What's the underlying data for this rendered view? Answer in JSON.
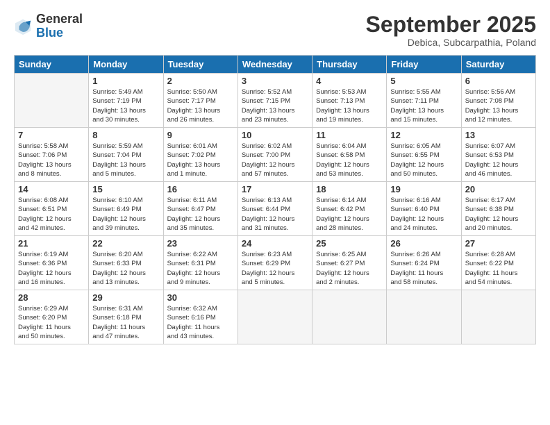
{
  "header": {
    "logo_general": "General",
    "logo_blue": "Blue",
    "month_title": "September 2025",
    "subtitle": "Debica, Subcarpathia, Poland"
  },
  "weekdays": [
    "Sunday",
    "Monday",
    "Tuesday",
    "Wednesday",
    "Thursday",
    "Friday",
    "Saturday"
  ],
  "weeks": [
    [
      {
        "day": "",
        "info": ""
      },
      {
        "day": "1",
        "info": "Sunrise: 5:49 AM\nSunset: 7:19 PM\nDaylight: 13 hours\nand 30 minutes."
      },
      {
        "day": "2",
        "info": "Sunrise: 5:50 AM\nSunset: 7:17 PM\nDaylight: 13 hours\nand 26 minutes."
      },
      {
        "day": "3",
        "info": "Sunrise: 5:52 AM\nSunset: 7:15 PM\nDaylight: 13 hours\nand 23 minutes."
      },
      {
        "day": "4",
        "info": "Sunrise: 5:53 AM\nSunset: 7:13 PM\nDaylight: 13 hours\nand 19 minutes."
      },
      {
        "day": "5",
        "info": "Sunrise: 5:55 AM\nSunset: 7:11 PM\nDaylight: 13 hours\nand 15 minutes."
      },
      {
        "day": "6",
        "info": "Sunrise: 5:56 AM\nSunset: 7:08 PM\nDaylight: 13 hours\nand 12 minutes."
      }
    ],
    [
      {
        "day": "7",
        "info": "Sunrise: 5:58 AM\nSunset: 7:06 PM\nDaylight: 13 hours\nand 8 minutes."
      },
      {
        "day": "8",
        "info": "Sunrise: 5:59 AM\nSunset: 7:04 PM\nDaylight: 13 hours\nand 5 minutes."
      },
      {
        "day": "9",
        "info": "Sunrise: 6:01 AM\nSunset: 7:02 PM\nDaylight: 13 hours\nand 1 minute."
      },
      {
        "day": "10",
        "info": "Sunrise: 6:02 AM\nSunset: 7:00 PM\nDaylight: 12 hours\nand 57 minutes."
      },
      {
        "day": "11",
        "info": "Sunrise: 6:04 AM\nSunset: 6:58 PM\nDaylight: 12 hours\nand 53 minutes."
      },
      {
        "day": "12",
        "info": "Sunrise: 6:05 AM\nSunset: 6:55 PM\nDaylight: 12 hours\nand 50 minutes."
      },
      {
        "day": "13",
        "info": "Sunrise: 6:07 AM\nSunset: 6:53 PM\nDaylight: 12 hours\nand 46 minutes."
      }
    ],
    [
      {
        "day": "14",
        "info": "Sunrise: 6:08 AM\nSunset: 6:51 PM\nDaylight: 12 hours\nand 42 minutes."
      },
      {
        "day": "15",
        "info": "Sunrise: 6:10 AM\nSunset: 6:49 PM\nDaylight: 12 hours\nand 39 minutes."
      },
      {
        "day": "16",
        "info": "Sunrise: 6:11 AM\nSunset: 6:47 PM\nDaylight: 12 hours\nand 35 minutes."
      },
      {
        "day": "17",
        "info": "Sunrise: 6:13 AM\nSunset: 6:44 PM\nDaylight: 12 hours\nand 31 minutes."
      },
      {
        "day": "18",
        "info": "Sunrise: 6:14 AM\nSunset: 6:42 PM\nDaylight: 12 hours\nand 28 minutes."
      },
      {
        "day": "19",
        "info": "Sunrise: 6:16 AM\nSunset: 6:40 PM\nDaylight: 12 hours\nand 24 minutes."
      },
      {
        "day": "20",
        "info": "Sunrise: 6:17 AM\nSunset: 6:38 PM\nDaylight: 12 hours\nand 20 minutes."
      }
    ],
    [
      {
        "day": "21",
        "info": "Sunrise: 6:19 AM\nSunset: 6:36 PM\nDaylight: 12 hours\nand 16 minutes."
      },
      {
        "day": "22",
        "info": "Sunrise: 6:20 AM\nSunset: 6:33 PM\nDaylight: 12 hours\nand 13 minutes."
      },
      {
        "day": "23",
        "info": "Sunrise: 6:22 AM\nSunset: 6:31 PM\nDaylight: 12 hours\nand 9 minutes."
      },
      {
        "day": "24",
        "info": "Sunrise: 6:23 AM\nSunset: 6:29 PM\nDaylight: 12 hours\nand 5 minutes."
      },
      {
        "day": "25",
        "info": "Sunrise: 6:25 AM\nSunset: 6:27 PM\nDaylight: 12 hours\nand 2 minutes."
      },
      {
        "day": "26",
        "info": "Sunrise: 6:26 AM\nSunset: 6:24 PM\nDaylight: 11 hours\nand 58 minutes."
      },
      {
        "day": "27",
        "info": "Sunrise: 6:28 AM\nSunset: 6:22 PM\nDaylight: 11 hours\nand 54 minutes."
      }
    ],
    [
      {
        "day": "28",
        "info": "Sunrise: 6:29 AM\nSunset: 6:20 PM\nDaylight: 11 hours\nand 50 minutes."
      },
      {
        "day": "29",
        "info": "Sunrise: 6:31 AM\nSunset: 6:18 PM\nDaylight: 11 hours\nand 47 minutes."
      },
      {
        "day": "30",
        "info": "Sunrise: 6:32 AM\nSunset: 6:16 PM\nDaylight: 11 hours\nand 43 minutes."
      },
      {
        "day": "",
        "info": ""
      },
      {
        "day": "",
        "info": ""
      },
      {
        "day": "",
        "info": ""
      },
      {
        "day": "",
        "info": ""
      }
    ]
  ]
}
